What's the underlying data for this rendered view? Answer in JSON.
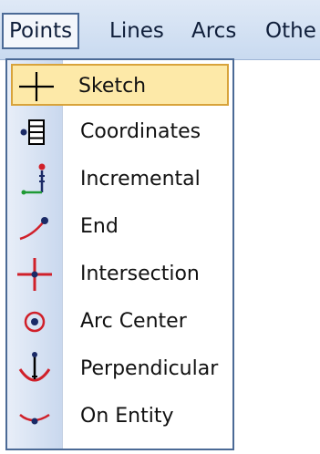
{
  "menubar": {
    "items": [
      {
        "label": "Points",
        "active": true
      },
      {
        "label": "Lines",
        "active": false
      },
      {
        "label": "Arcs",
        "active": false
      },
      {
        "label": "Othe",
        "active": false
      }
    ]
  },
  "menu": {
    "items": [
      {
        "label": "Sketch",
        "icon": "sketch-crosshair-icon",
        "selected": true
      },
      {
        "label": "Coordinates",
        "icon": "coordinates-icon",
        "selected": false
      },
      {
        "label": "Incremental",
        "icon": "incremental-icon",
        "selected": false
      },
      {
        "label": "End",
        "icon": "end-point-icon",
        "selected": false
      },
      {
        "label": "Intersection",
        "icon": "intersection-icon",
        "selected": false
      },
      {
        "label": "Arc Center",
        "icon": "arc-center-icon",
        "selected": false
      },
      {
        "label": "Perpendicular",
        "icon": "perpendicular-icon",
        "selected": false
      },
      {
        "label": "On Entity",
        "icon": "on-entity-icon",
        "selected": false
      }
    ]
  },
  "colors": {
    "menubar_bg": "#c9daf0",
    "selection_bg": "#fde9a8",
    "selection_border": "#d8a33b",
    "frame_border": "#4b6a96",
    "icon_red": "#d0202a",
    "icon_green": "#1f9a35",
    "icon_blue": "#1a2a66"
  }
}
